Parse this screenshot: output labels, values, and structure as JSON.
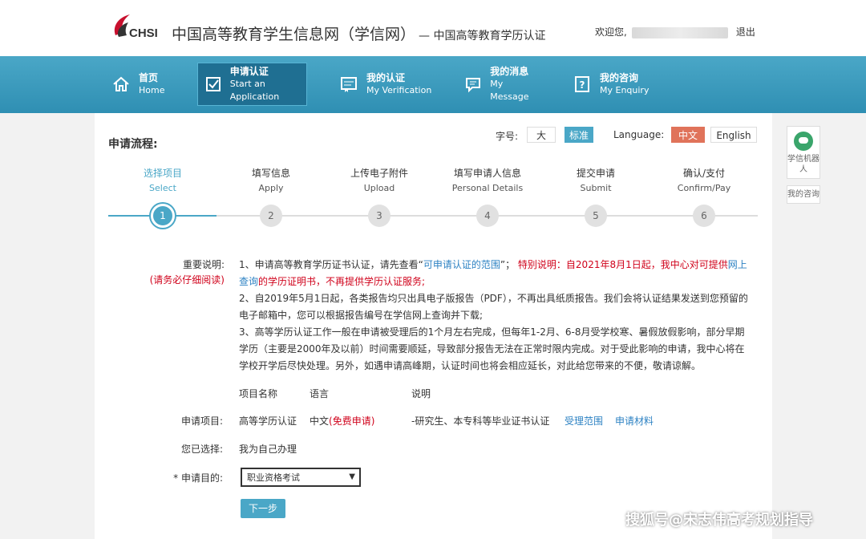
{
  "header": {
    "logo_text": "CHSI",
    "site_title": "中国高等教育学生信息网（学信网）",
    "site_subtitle": "— 中国高等教育学历认证",
    "welcome": "欢迎您,",
    "logout": "退出"
  },
  "nav": [
    {
      "zh": "首页",
      "en": "Home",
      "icon": "home-icon"
    },
    {
      "zh": "申请认证",
      "en": "Start an Application",
      "icon": "checkbox-icon",
      "active": true
    },
    {
      "zh": "我的认证",
      "en": "My Verification",
      "icon": "certificate-icon"
    },
    {
      "zh": "我的消息",
      "en": "My Message",
      "icon": "chat-icon"
    },
    {
      "zh": "我的咨询",
      "en": "My Enquiry",
      "icon": "question-icon"
    }
  ],
  "main": {
    "flow_title": "申请流程:",
    "font_size_label": "字号:",
    "font_big": "大",
    "font_std": "标准",
    "language_label": "Language:",
    "lang_zh": "中文",
    "lang_en": "English"
  },
  "steps": [
    {
      "zh": "选择项目",
      "en": "Select",
      "num": "1"
    },
    {
      "zh": "填写信息",
      "en": "Apply",
      "num": "2"
    },
    {
      "zh": "上传电子附件",
      "en": "Upload",
      "num": "3"
    },
    {
      "zh": "填写申请人信息",
      "en": "Personal Details",
      "num": "4"
    },
    {
      "zh": "提交申请",
      "en": "Submit",
      "num": "5"
    },
    {
      "zh": "确认/支付",
      "en": "Confirm/Pay",
      "num": "6"
    }
  ],
  "notes": {
    "label": "重要说明:",
    "label_sub": "(请务必仔细阅读)",
    "n1_a": "1、申请高等教育学历证书认证，请先查看“",
    "n1_link": "可申请认证的范围",
    "n1_b": "”；",
    "n1_red_a": "特别说明：自2021年8月1日起，我中心对可提供",
    "n1_link2": "网上查询",
    "n1_red_b": "的学历证明书，不再提供学历认证服务;",
    "n2": "2、自2019年5月1日起，各类报告均只出具电子版报告（PDF），不再出具纸质报告。我们会将认证结果发送到您预留的电子邮箱中，您可以根据报告编号在学信网上查询并下载;",
    "n3": "3、高等学历认证工作一般在申请被受理后的1个月左右完成，但每年1-2月、6-8月受学校寒、暑假放假影响，部分早期学历（主要是2000年及以前）时间需要顺延，导致部分报告无法在正常时限内完成。对于受此影响的申请，我中心将在学校开学后尽快处理。另外，如遇申请高峰期，认证时间也将会相应延长，对此给您带来的不便，敬请谅解。"
  },
  "table": {
    "col_name": "项目名称",
    "col_lang": "语言",
    "col_desc": "说明",
    "row_label": "申请项目:",
    "item_name": "高等学历认证",
    "item_lang": "中文",
    "item_free": "(免费申请)",
    "item_desc": "-研究生、本专科等毕业证书认证",
    "link_scope": "受理范围",
    "link_materials": "申请材料"
  },
  "choice": {
    "label": "您已选择:",
    "value": "我为自己办理"
  },
  "purpose": {
    "label": "* 申请目的:",
    "selected": "职业资格考试"
  },
  "next_button": "下一步",
  "side": {
    "robot_label": "学信机器人",
    "consult_label": "我的咨询"
  },
  "watermark": "搜狐号@宋志伟高考规划指导",
  "colors": {
    "accent": "#4aa7c7",
    "link": "#2d82c3",
    "warning": "#d0021b"
  }
}
